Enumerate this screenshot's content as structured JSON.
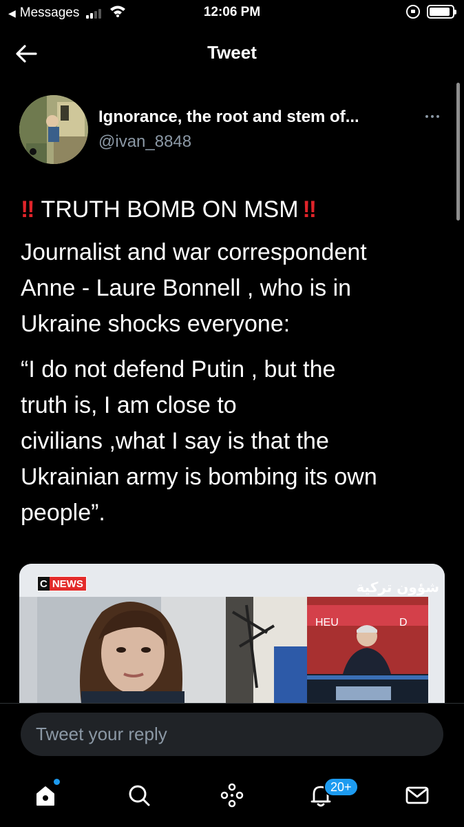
{
  "status_bar": {
    "back_app": "Messages",
    "time": "12:06 PM",
    "signal_bars": 2,
    "battery_level": 0.9
  },
  "header": {
    "title": "Tweet",
    "back_icon": "arrow-left-icon"
  },
  "tweet": {
    "author": {
      "display_name": "Ignorance, the root and stem of...",
      "handle": "@ivan_8848"
    },
    "headline_mark": "‼",
    "headline": "TRUTH BOMB ON MSM",
    "paragraph1_lines": [
      "Journalist and war correspondent",
      "Anne - Laure Bonnell ,  who is in",
      "Ukraine shocks everyone:"
    ],
    "paragraph2_lines": [
      "“I do not defend Putin , but the",
      "truth is, I am close to",
      "civilians ,what I say is that the",
      "Ukrainian army is bombing its own",
      "people”."
    ],
    "media": {
      "logo": "NEWS",
      "logo_prefix": "C",
      "watermark": "شؤون تركية"
    }
  },
  "reply": {
    "placeholder": "Tweet your reply"
  },
  "bottom_nav": {
    "items": [
      "home-icon",
      "search-icon",
      "spaces-icon",
      "notifications-icon",
      "messages-icon"
    ],
    "notification_badge": "20+"
  },
  "colors": {
    "background": "#000000",
    "accent": "#1d9bf0",
    "muted": "#8b98a5",
    "alert_red": "#e0242a"
  }
}
